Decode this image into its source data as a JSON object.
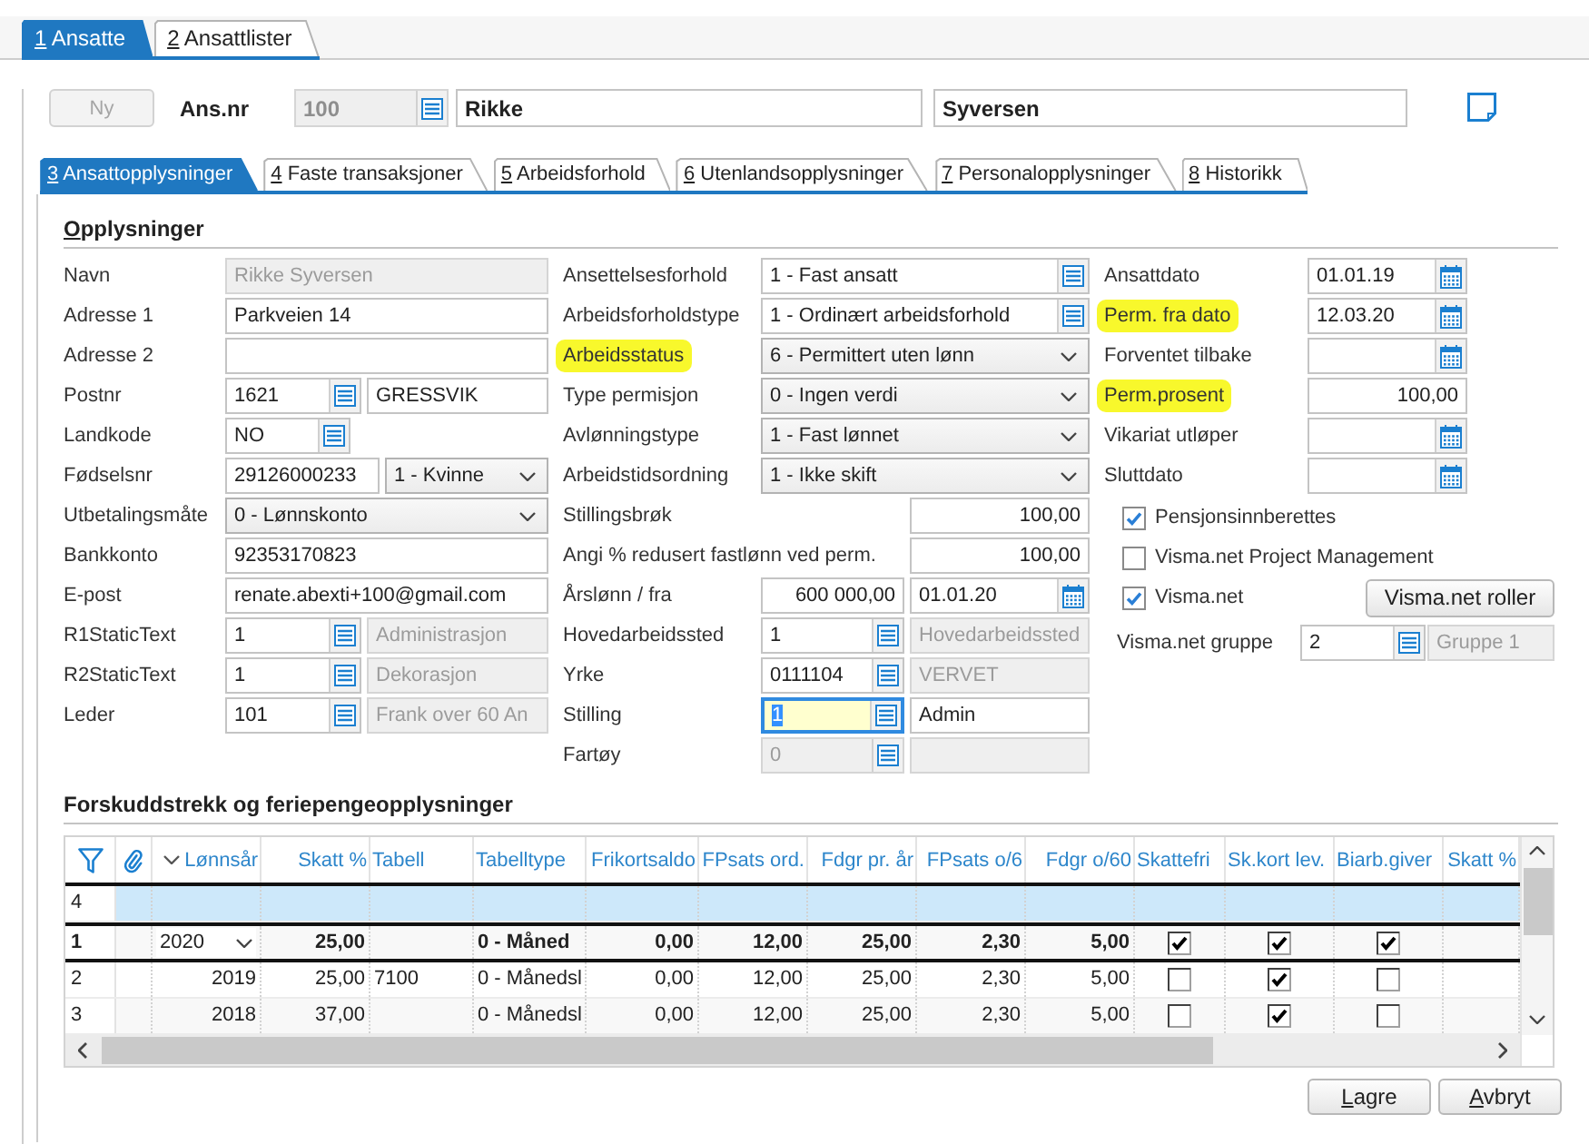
{
  "main_tabs": [
    {
      "label": "1 Ansatte",
      "selected": true
    },
    {
      "label": "2 Ansattlister",
      "selected": false
    }
  ],
  "header": {
    "new_button": {
      "label": "Ny",
      "disabled": true
    },
    "employee_no_label": "Ans.nr",
    "employee_no": {
      "value": "100",
      "disabled": true
    },
    "first_name": "Rikke",
    "last_name": "Syversen"
  },
  "sub_tabs": [
    {
      "label": "3 Ansattopplysninger",
      "selected": true
    },
    {
      "label": "4 Faste transaksjoner",
      "selected": false
    },
    {
      "label": "5 Arbeidsforhold",
      "selected": false
    },
    {
      "label": "6 Utenlandsopplysninger",
      "selected": false
    },
    {
      "label": "7 Personalopplysninger",
      "selected": false
    },
    {
      "label": "8 Historikk",
      "selected": false
    }
  ],
  "info": {
    "title": "Opplysninger",
    "columns": [
      {
        "rows": [
          {
            "label": "Navn",
            "highlighted": false,
            "controls": [
              {
                "kind": "text",
                "value": "Rikke Syversen",
                "disabled": true,
                "focused": false
              }
            ]
          },
          {
            "label": "Adresse 1",
            "highlighted": false,
            "controls": [
              {
                "kind": "text",
                "value": "Parkveien 14",
                "disabled": false,
                "focused": false
              }
            ]
          },
          {
            "label": "Adresse 2",
            "highlighted": false,
            "controls": [
              {
                "kind": "text",
                "disabled": false,
                "focused": false
              }
            ]
          },
          {
            "label": "Postnr",
            "highlighted": false,
            "controls": [
              {
                "kind": "lookup",
                "value": "1621",
                "disabled": false,
                "focused": false
              },
              {
                "kind": "text",
                "value": "GRESSVIK",
                "disabled": false,
                "focused": false
              }
            ]
          },
          {
            "label": "Landkode",
            "highlighted": false,
            "controls": [
              {
                "kind": "lookup",
                "value": "NO",
                "disabled": false,
                "focused": false
              }
            ]
          },
          {
            "label": "Fødselsnr",
            "highlighted": false,
            "controls": [
              {
                "kind": "text",
                "value": "29126000233",
                "disabled": false,
                "focused": false
              },
              {
                "kind": "select",
                "value": "1 - Kvinne",
                "disabled": false,
                "focused": false
              }
            ]
          },
          {
            "label": "Utbetalingsmåte",
            "highlighted": false,
            "controls": [
              {
                "kind": "select",
                "value": "0 - Lønnskonto",
                "disabled": false,
                "focused": false
              }
            ]
          },
          {
            "label": "Bankkonto",
            "highlighted": false,
            "controls": [
              {
                "kind": "text",
                "value": "92353170823",
                "disabled": false,
                "focused": false
              }
            ]
          },
          {
            "label": "E-post",
            "highlighted": false,
            "controls": [
              {
                "kind": "text",
                "value": "renate.abexti+100@gmail.com",
                "disabled": false,
                "focused": false
              }
            ]
          },
          {
            "label": "R1StaticText",
            "highlighted": false,
            "controls": [
              {
                "kind": "lookup",
                "value": "1",
                "disabled": false,
                "focused": false
              },
              {
                "kind": "text",
                "value": "Administrasjon",
                "disabled": true,
                "focused": false
              }
            ]
          },
          {
            "label": "R2StaticText",
            "highlighted": false,
            "controls": [
              {
                "kind": "lookup",
                "value": "1",
                "disabled": false,
                "focused": false
              },
              {
                "kind": "text",
                "value": "Dekorasjon",
                "disabled": true,
                "focused": false
              }
            ]
          },
          {
            "label": "Leder",
            "highlighted": false,
            "controls": [
              {
                "kind": "lookup",
                "value": "101",
                "disabled": false,
                "focused": false
              },
              {
                "kind": "text",
                "value": "Frank over 60 An",
                "disabled": true,
                "focused": false
              }
            ]
          }
        ]
      },
      {
        "rows": [
          {
            "label": "Ansettelsesforhold",
            "highlighted": false,
            "controls": [
              {
                "kind": "lookup",
                "value": "1 - Fast ansatt",
                "disabled": false,
                "focused": false
              }
            ]
          },
          {
            "label": "Arbeidsforholdstype",
            "highlighted": false,
            "controls": [
              {
                "kind": "lookup",
                "value": "1 - Ordinært arbeidsforhold",
                "disabled": false,
                "focused": false
              }
            ]
          },
          {
            "label": "Arbeidsstatus",
            "highlighted": true,
            "controls": [
              {
                "kind": "select",
                "value": "6 - Permittert uten lønn",
                "disabled": false,
                "focused": false
              }
            ]
          },
          {
            "label": "Type permisjon",
            "highlighted": false,
            "controls": [
              {
                "kind": "select",
                "value": "0 - Ingen verdi",
                "disabled": false,
                "focused": false
              }
            ]
          },
          {
            "label": "Avlønningstype",
            "highlighted": false,
            "controls": [
              {
                "kind": "select",
                "value": "1 - Fast lønnet",
                "disabled": false,
                "focused": false
              }
            ]
          },
          {
            "label": "Arbeidstidsordning",
            "highlighted": false,
            "controls": [
              {
                "kind": "select",
                "value": "1 - Ikke skift",
                "disabled": false,
                "focused": false
              }
            ]
          },
          {
            "label": "Stillingsbrøk",
            "highlighted": false,
            "controls": [
              {
                "kind": "number",
                "value": "100,00",
                "disabled": false,
                "focused": false
              }
            ]
          },
          {
            "label": "Angi % redusert fastlønn ved perm.",
            "highlighted": false,
            "controls": [
              {
                "kind": "number",
                "value": "100,00",
                "disabled": false,
                "focused": false
              }
            ]
          },
          {
            "label": "Årslønn / fra",
            "highlighted": false,
            "controls": [
              {
                "kind": "number",
                "value": "600 000,00",
                "disabled": false,
                "focused": false
              },
              {
                "kind": "date",
                "value": "01.01.20",
                "disabled": false,
                "focused": false
              }
            ]
          },
          {
            "label": "Hovedarbeidssted",
            "highlighted": false,
            "controls": [
              {
                "kind": "lookup",
                "value": "1",
                "disabled": false,
                "focused": false
              },
              {
                "kind": "text",
                "value": "Hovedarbeidssted",
                "disabled": true,
                "focused": false
              }
            ]
          },
          {
            "label": "Yrke",
            "highlighted": false,
            "controls": [
              {
                "kind": "lookup",
                "value": "0111104",
                "disabled": false,
                "focused": false
              },
              {
                "kind": "text",
                "value": "VERVET",
                "disabled": true,
                "focused": false
              }
            ]
          },
          {
            "label": "Stilling",
            "highlighted": false,
            "controls": [
              {
                "kind": "lookup",
                "value": "1",
                "disabled": false,
                "focused": true
              },
              {
                "kind": "text",
                "value": "Admin",
                "disabled": false,
                "focused": false
              }
            ]
          },
          {
            "label": "Fartøy",
            "highlighted": false,
            "controls": [
              {
                "kind": "lookup",
                "value": "0",
                "disabled": true,
                "focused": false
              },
              {
                "kind": "text",
                "disabled": true,
                "focused": false
              }
            ]
          }
        ]
      },
      {
        "rows": [
          {
            "label": "Ansattdato",
            "highlighted": false,
            "controls": [
              {
                "kind": "date",
                "value": "01.01.19",
                "disabled": false,
                "focused": false
              }
            ]
          },
          {
            "label": "Perm. fra dato",
            "highlighted": true,
            "controls": [
              {
                "kind": "date",
                "value": "12.03.20",
                "disabled": false,
                "focused": false
              }
            ]
          },
          {
            "label": "Forventet tilbake",
            "highlighted": false,
            "controls": [
              {
                "kind": "date",
                "disabled": false,
                "focused": false
              }
            ]
          },
          {
            "label": "Perm.prosent",
            "highlighted": true,
            "controls": [
              {
                "kind": "number",
                "value": "100,00",
                "disabled": false,
                "focused": false
              }
            ]
          },
          {
            "label": "Vikariat utløper",
            "highlighted": false,
            "controls": [
              {
                "kind": "date",
                "disabled": false,
                "focused": false
              }
            ]
          },
          {
            "label": "Sluttdato",
            "highlighted": false,
            "controls": [
              {
                "kind": "date",
                "disabled": false,
                "focused": false
              }
            ]
          }
        ],
        "checkboxes": [
          {
            "label": "Pensjonsinnberettes",
            "checked": true
          },
          {
            "label": "Visma.net Project Management",
            "checked": false
          },
          {
            "label": "Visma.net",
            "checked": true,
            "button": {
              "label": "Visma.net roller"
            }
          }
        ],
        "group_field": {
          "label": "Visma.net gruppe",
          "lookup": {
            "kind": "lookup",
            "value": "2",
            "disabled": false,
            "focused": false
          },
          "name_field": {
            "kind": "text",
            "value": "Gruppe 1",
            "disabled": true,
            "focused": false
          }
        }
      }
    ]
  },
  "tax_table": {
    "title": "Forskuddstrekk og feriepengeopplysninger",
    "columns": [
      {
        "label": "Lønnsår",
        "kind": "select",
        "sorted": true
      },
      {
        "label": "Skatt %",
        "kind": "number",
        "sorted": false
      },
      {
        "label": "Tabell",
        "kind": "text",
        "sorted": false
      },
      {
        "label": "Tabelltype",
        "kind": "text",
        "sorted": false
      },
      {
        "label": "Frikortsaldo",
        "kind": "number",
        "sorted": false
      },
      {
        "label": "FPsats ord.",
        "kind": "number",
        "sorted": false
      },
      {
        "label": "Fdgr pr. år",
        "kind": "number",
        "sorted": false
      },
      {
        "label": "FPsats o/6",
        "kind": "number",
        "sorted": false
      },
      {
        "label": "Fdgr o/60",
        "kind": "number",
        "sorted": false
      },
      {
        "label": "Skattefri",
        "kind": "check",
        "sorted": false
      },
      {
        "label": "Sk.kort lev.",
        "kind": "check",
        "sorted": false
      },
      {
        "label": "Biarb.giver",
        "kind": "check",
        "sorted": false
      },
      {
        "label": "Skatt %",
        "kind": "number",
        "sorted": false
      }
    ],
    "rows": [
      {
        "number": "4",
        "kind": "new",
        "current": false
      },
      {
        "number": "1",
        "kind": "data",
        "current": true,
        "cells": [
          "2020",
          "25,00",
          null,
          "0 - Måned",
          "0,00",
          "12,00",
          "25,00",
          "2,30",
          "5,00",
          true,
          true,
          true,
          null
        ]
      },
      {
        "number": "2",
        "kind": "data",
        "current": false,
        "cells": [
          "2019",
          "25,00",
          "7100",
          "0 - Månedsl",
          "0,00",
          "12,00",
          "25,00",
          "2,30",
          "5,00",
          false,
          true,
          false,
          null
        ]
      },
      {
        "number": "3",
        "kind": "data",
        "current": false,
        "cells": [
          "2018",
          "37,00",
          null,
          "0 - Månedsl",
          "0,00",
          "12,00",
          "25,00",
          "2,30",
          "5,00",
          false,
          true,
          false,
          null
        ]
      }
    ]
  },
  "buttons": [
    {
      "label": "Lagre"
    },
    {
      "label": "Avbryt"
    }
  ]
}
